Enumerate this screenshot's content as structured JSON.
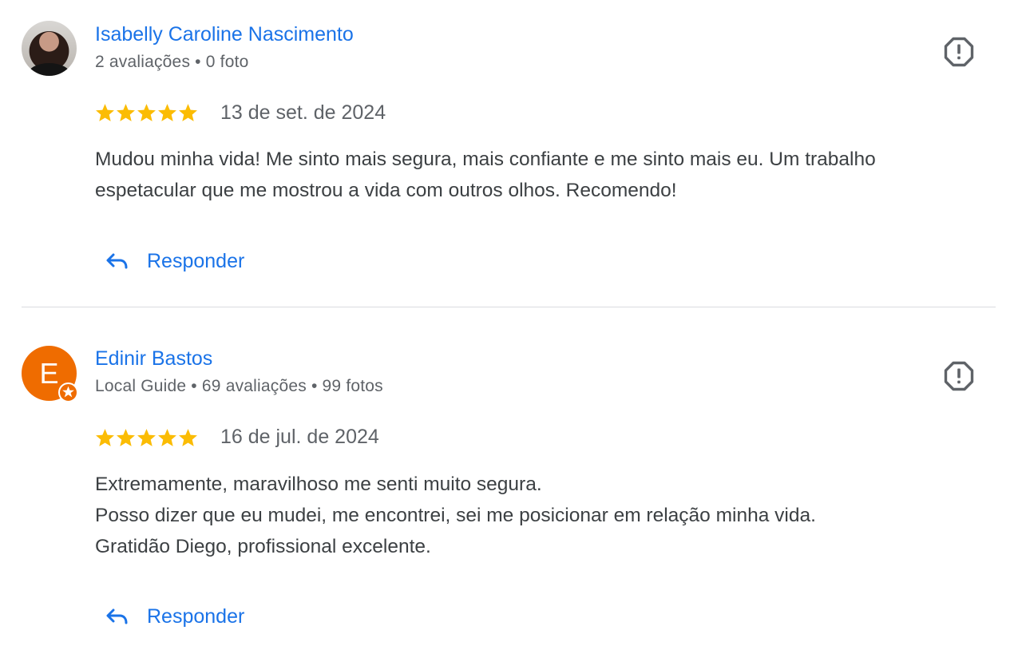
{
  "reviews": [
    {
      "author": "Isabelly Caroline Nascimento",
      "meta": "2 avaliações • 0 foto",
      "rating": 5,
      "date": "13 de set. de 2024",
      "text_lines": [
        "Mudou minha vida! Me sinto mais segura, mais confiante e me sinto mais eu. Um trabalho",
        "espetacular que me mostrou a vida com outros olhos. Recomendo!"
      ],
      "reply_label": "Responder",
      "avatar_type": "photo"
    },
    {
      "author": "Edinir Bastos",
      "meta": "Local Guide • 69 avaliações • 99 fotos",
      "rating": 5,
      "date": "16 de jul. de 2024",
      "avatar_initial": "E",
      "avatar_color": "#ef6c00",
      "text_lines": [
        "Extremamente, maravilhoso me senti muito segura.",
        "Posso dizer que eu mudei, me encontrei, sei me posicionar em relação minha vida.",
        "Gratidão Diego, profissional excelente."
      ],
      "reply_label": "Responder",
      "avatar_type": "letter"
    }
  ],
  "colors": {
    "link": "#1a73e8",
    "star": "#fbbc04",
    "secondary_text": "#5f6368",
    "body_text": "#3c4043",
    "divider": "#dadce0"
  },
  "icons": {
    "report": "flag-report-icon",
    "reply": "reply-arrow-icon",
    "star": "star-icon",
    "local_guide": "local-guide-badge-icon"
  }
}
